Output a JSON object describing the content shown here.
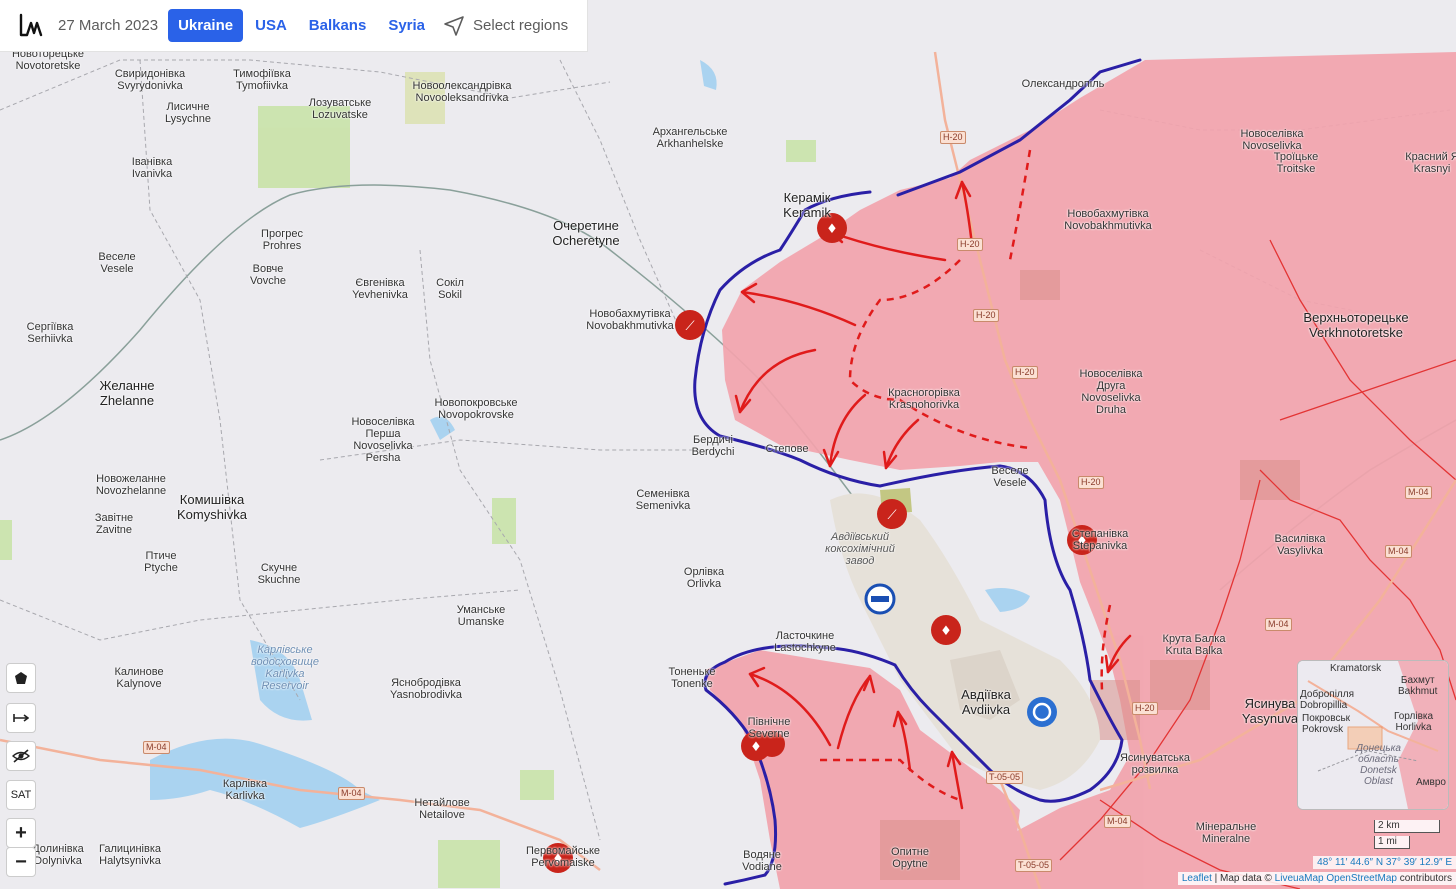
{
  "header": {
    "date": "27 March 2023",
    "regions": [
      "Ukraine",
      "USA",
      "Balkans",
      "Syria"
    ],
    "active_region": "Ukraine",
    "select_regions": "Select regions"
  },
  "labels": {
    "novotoretske": "Новоторецьке\nNovotoretske",
    "svyrydonivka": "Свиридонівка\nSvyrydonivka",
    "tymofiivka": "Тимофіївка\nTymofiivka",
    "novooleksandrivka": "Новоолександрівка\nNovooleksandrivka",
    "lysychne": "Лисичне\nLysychne",
    "lozuvatske": "Лозуватське\nLozuvatske",
    "arkhanhelske": "Архангельське\nArkhanhelske",
    "oleksandropil": "Олександропіль",
    "novoselivka": "Новоселівка\nNovoselivka",
    "troitske": "Троїцьке\nTroitske",
    "krasnyi": "Красний Я\nKrasnyi",
    "ivanivka": "Іванівка\nIvanivka",
    "keramik": "Керамік\nKeramik",
    "ocheretyne": "Очеретине\nOcheretyne",
    "novobakhmutivka_e": "Новобахмутівка\nNovobakhmutivka",
    "prohres": "Прогрес\nProhres",
    "vesele_w": "Веселе\nVesele",
    "vovche": "Вовче\nVovche",
    "yevhenivka": "Євгенівка\nYevhenivka",
    "sokil": "Сокіл\nSokil",
    "serhiivka": "Сергіївка\nSerhiivka",
    "novobakhmutivka_w": "Новобахмутівка\nNovobakhmutivka",
    "verkhnotoretske": "Верхньоторецьке\nVerkhnotoretske",
    "zhelanne": "Желанне\nZhelanne",
    "novopokrovske": "Новопокровське\nNovopokrovske",
    "krasnohorivka": "Красногорівка\nKrasnohorivka",
    "novoselivka_druha": "Новоселівка\nДруга\nNovoselivka\nDruha",
    "novoselivka_persha": "Новоселівка\nПерша\nNovoselivka\nPersha",
    "berdychi": "Бердичі\nBerdychi",
    "stepove": "Степове",
    "vesele_e": "Веселе\nVesele",
    "novozhelanne": "Новожеланне\nNovozhelanne",
    "komyshivka": "Комишівка\nKomyshivka",
    "semenivka": "Семенівка\nSemenivka",
    "zavitne": "Завітне\nZavitne",
    "coke_plant": "Авдіївський\nкоксохімічний\nзавод",
    "stepanivka": "Степанівка\nStepanivka",
    "vasylivka": "Василівка\nVasylivka",
    "ptyche": "Птиче\nPtyche",
    "skuchne": "Скучне\nSkuchne",
    "orlivka": "Орлівка\nOrlivka",
    "umanske": "Уманське\nUmanske",
    "lastochkyne": "Ласточкине\nLastochkyne",
    "kruta_balka": "Крута Балка\nKruta Balka",
    "reservoir": "Карлівське\nводосховище\nKarlivka\nReservoir",
    "kalynove": "Калинове\nKalynove",
    "tonenke": "Тоненьке\nTonenke",
    "yasnobrodivka": "Яснобродівка\nYasnobrodivka",
    "avdiivka": "Авдіївка\nAvdiivka",
    "yasynuvata": "Ясинува\nYasynuva",
    "pivnichne": "Північне\nSeverne",
    "yasynuvata_junction": "Ясинуватська\nрозвилка",
    "karlivka": "Карлівка\nKarlivka",
    "netailove": "Нетайлове\nNetailove",
    "mineralne": "Мінеральне\nMineralne",
    "dolynivka": "Долинівка\nDolynivka",
    "halytsynivka": "Галицинівка\nHalytsynivka",
    "pervomaiske": "Первомайське\nPervomaiske",
    "vodiane": "Водяне\nVodiane",
    "opytne": "Опитне\nOpytne"
  },
  "roads": [
    "H-20",
    "H-20",
    "H-20",
    "H-20",
    "H-20",
    "H-20",
    "M-04",
    "M-04",
    "M-04",
    "M-04",
    "M-04",
    "M-04",
    "T-05-05",
    "T-05-05"
  ],
  "controls": {
    "polygon_icon": "pentagon-icon",
    "measure_icon": "arrows-icon",
    "hide_icon": "eye-slash-icon",
    "sat": "SAT",
    "zoom_in": "+",
    "zoom_out": "−"
  },
  "minimap": {
    "labels": [
      "Kramatorsk",
      "Бахмут\nBakhmut",
      "Добропілля\nDobropillia",
      "Покровськ\nPokrovsk",
      "Горлівка\nHorlivka",
      "Донецька\nобласть\nDonetsk\nOblast",
      "Амвро"
    ]
  },
  "scale": {
    "km": "2 km",
    "mi": "1 mi"
  },
  "coords": "48° 11′ 44.6″ N 37° 39′ 12.9″ E",
  "attribution": {
    "leaflet": "Leaflet",
    "sep1": " | Map data © ",
    "liveuamap": "LiveuaMap",
    "sep2": " ",
    "osm": "OpenStreetMap",
    "tail": " contributors"
  },
  "colors": {
    "occupied": "#f2a3ac",
    "front": "#2a1fa6",
    "arrow": "#e01b1b",
    "accent": "#2a62e8"
  }
}
